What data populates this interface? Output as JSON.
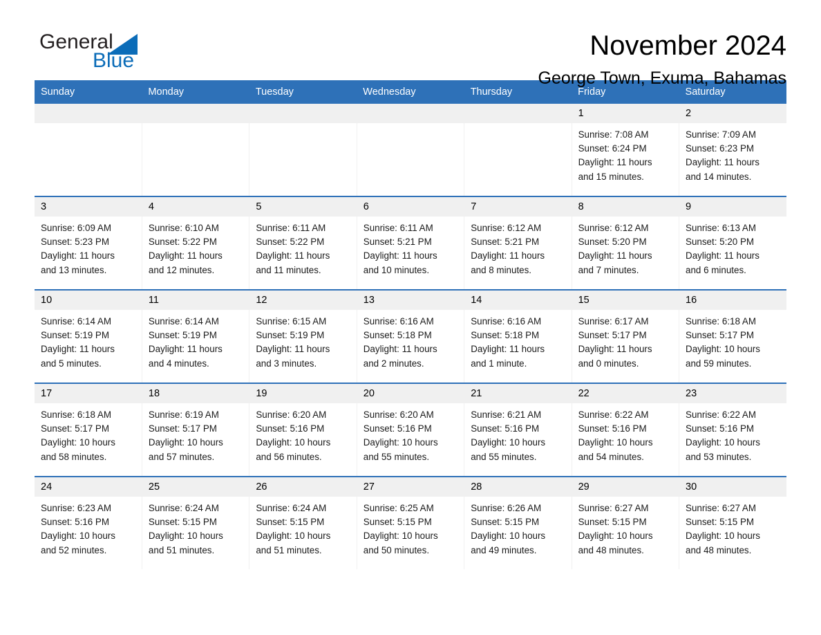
{
  "brand": {
    "name_part1": "General",
    "name_part2": "Blue",
    "triangle_icon": "blue-triangle-logo-mark",
    "accent_color": "#0b6cb8"
  },
  "header": {
    "month_title": "November 2024",
    "location": "George Town, Exuma, Bahamas"
  },
  "theme": {
    "header_blue": "#2e71b8",
    "daynum_gray": "#f0f0f0",
    "text_black": "#000000"
  },
  "calendar": {
    "weekday_headers": [
      "Sunday",
      "Monday",
      "Tuesday",
      "Wednesday",
      "Thursday",
      "Friday",
      "Saturday"
    ],
    "weeks": [
      [
        {
          "day": "",
          "lines": []
        },
        {
          "day": "",
          "lines": []
        },
        {
          "day": "",
          "lines": []
        },
        {
          "day": "",
          "lines": []
        },
        {
          "day": "",
          "lines": []
        },
        {
          "day": "1",
          "lines": [
            "Sunrise: 7:08 AM",
            "Sunset: 6:24 PM",
            "Daylight: 11 hours",
            "and 15 minutes."
          ]
        },
        {
          "day": "2",
          "lines": [
            "Sunrise: 7:09 AM",
            "Sunset: 6:23 PM",
            "Daylight: 11 hours",
            "and 14 minutes."
          ]
        }
      ],
      [
        {
          "day": "3",
          "lines": [
            "Sunrise: 6:09 AM",
            "Sunset: 5:23 PM",
            "Daylight: 11 hours",
            "and 13 minutes."
          ]
        },
        {
          "day": "4",
          "lines": [
            "Sunrise: 6:10 AM",
            "Sunset: 5:22 PM",
            "Daylight: 11 hours",
            "and 12 minutes."
          ]
        },
        {
          "day": "5",
          "lines": [
            "Sunrise: 6:11 AM",
            "Sunset: 5:22 PM",
            "Daylight: 11 hours",
            "and 11 minutes."
          ]
        },
        {
          "day": "6",
          "lines": [
            "Sunrise: 6:11 AM",
            "Sunset: 5:21 PM",
            "Daylight: 11 hours",
            "and 10 minutes."
          ]
        },
        {
          "day": "7",
          "lines": [
            "Sunrise: 6:12 AM",
            "Sunset: 5:21 PM",
            "Daylight: 11 hours",
            "and 8 minutes."
          ]
        },
        {
          "day": "8",
          "lines": [
            "Sunrise: 6:12 AM",
            "Sunset: 5:20 PM",
            "Daylight: 11 hours",
            "and 7 minutes."
          ]
        },
        {
          "day": "9",
          "lines": [
            "Sunrise: 6:13 AM",
            "Sunset: 5:20 PM",
            "Daylight: 11 hours",
            "and 6 minutes."
          ]
        }
      ],
      [
        {
          "day": "10",
          "lines": [
            "Sunrise: 6:14 AM",
            "Sunset: 5:19 PM",
            "Daylight: 11 hours",
            "and 5 minutes."
          ]
        },
        {
          "day": "11",
          "lines": [
            "Sunrise: 6:14 AM",
            "Sunset: 5:19 PM",
            "Daylight: 11 hours",
            "and 4 minutes."
          ]
        },
        {
          "day": "12",
          "lines": [
            "Sunrise: 6:15 AM",
            "Sunset: 5:19 PM",
            "Daylight: 11 hours",
            "and 3 minutes."
          ]
        },
        {
          "day": "13",
          "lines": [
            "Sunrise: 6:16 AM",
            "Sunset: 5:18 PM",
            "Daylight: 11 hours",
            "and 2 minutes."
          ]
        },
        {
          "day": "14",
          "lines": [
            "Sunrise: 6:16 AM",
            "Sunset: 5:18 PM",
            "Daylight: 11 hours",
            "and 1 minute."
          ]
        },
        {
          "day": "15",
          "lines": [
            "Sunrise: 6:17 AM",
            "Sunset: 5:17 PM",
            "Daylight: 11 hours",
            "and 0 minutes."
          ]
        },
        {
          "day": "16",
          "lines": [
            "Sunrise: 6:18 AM",
            "Sunset: 5:17 PM",
            "Daylight: 10 hours",
            "and 59 minutes."
          ]
        }
      ],
      [
        {
          "day": "17",
          "lines": [
            "Sunrise: 6:18 AM",
            "Sunset: 5:17 PM",
            "Daylight: 10 hours",
            "and 58 minutes."
          ]
        },
        {
          "day": "18",
          "lines": [
            "Sunrise: 6:19 AM",
            "Sunset: 5:17 PM",
            "Daylight: 10 hours",
            "and 57 minutes."
          ]
        },
        {
          "day": "19",
          "lines": [
            "Sunrise: 6:20 AM",
            "Sunset: 5:16 PM",
            "Daylight: 10 hours",
            "and 56 minutes."
          ]
        },
        {
          "day": "20",
          "lines": [
            "Sunrise: 6:20 AM",
            "Sunset: 5:16 PM",
            "Daylight: 10 hours",
            "and 55 minutes."
          ]
        },
        {
          "day": "21",
          "lines": [
            "Sunrise: 6:21 AM",
            "Sunset: 5:16 PM",
            "Daylight: 10 hours",
            "and 55 minutes."
          ]
        },
        {
          "day": "22",
          "lines": [
            "Sunrise: 6:22 AM",
            "Sunset: 5:16 PM",
            "Daylight: 10 hours",
            "and 54 minutes."
          ]
        },
        {
          "day": "23",
          "lines": [
            "Sunrise: 6:22 AM",
            "Sunset: 5:16 PM",
            "Daylight: 10 hours",
            "and 53 minutes."
          ]
        }
      ],
      [
        {
          "day": "24",
          "lines": [
            "Sunrise: 6:23 AM",
            "Sunset: 5:16 PM",
            "Daylight: 10 hours",
            "and 52 minutes."
          ]
        },
        {
          "day": "25",
          "lines": [
            "Sunrise: 6:24 AM",
            "Sunset: 5:15 PM",
            "Daylight: 10 hours",
            "and 51 minutes."
          ]
        },
        {
          "day": "26",
          "lines": [
            "Sunrise: 6:24 AM",
            "Sunset: 5:15 PM",
            "Daylight: 10 hours",
            "and 51 minutes."
          ]
        },
        {
          "day": "27",
          "lines": [
            "Sunrise: 6:25 AM",
            "Sunset: 5:15 PM",
            "Daylight: 10 hours",
            "and 50 minutes."
          ]
        },
        {
          "day": "28",
          "lines": [
            "Sunrise: 6:26 AM",
            "Sunset: 5:15 PM",
            "Daylight: 10 hours",
            "and 49 minutes."
          ]
        },
        {
          "day": "29",
          "lines": [
            "Sunrise: 6:27 AM",
            "Sunset: 5:15 PM",
            "Daylight: 10 hours",
            "and 48 minutes."
          ]
        },
        {
          "day": "30",
          "lines": [
            "Sunrise: 6:27 AM",
            "Sunset: 5:15 PM",
            "Daylight: 10 hours",
            "and 48 minutes."
          ]
        }
      ]
    ]
  }
}
